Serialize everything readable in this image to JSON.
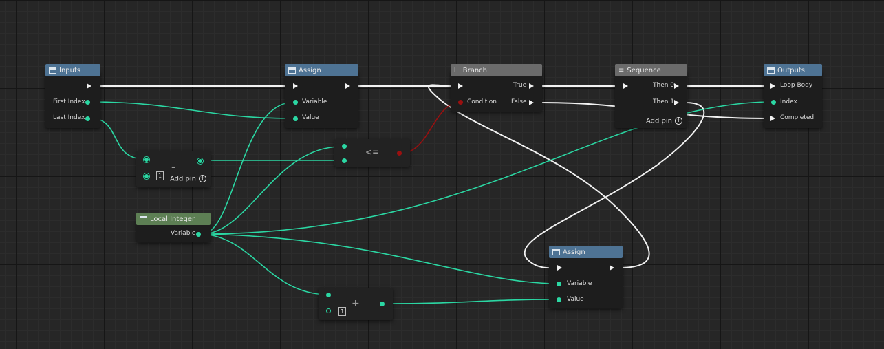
{
  "colors": {
    "background": "#262626",
    "node_body": "#1d1d1d",
    "header_blue": "#4e7394",
    "header_gray": "#6b6b6b",
    "header_green": "#5d7f54",
    "data_wire": "#2bd7a3",
    "exec_wire": "#f2f2f2",
    "bool_wire": "#9a1010"
  },
  "nodes": {
    "inputs": {
      "title": "Inputs",
      "first_index": "First Index",
      "last_index": "Last Index"
    },
    "assign_top": {
      "title": "Assign",
      "variable": "Variable",
      "value": "Value"
    },
    "branch": {
      "title": "Branch",
      "condition": "Condition",
      "true_label": "True",
      "false_label": "False"
    },
    "sequence": {
      "title": "Sequence",
      "then0": "Then 0",
      "then1": "Then 1",
      "add_pin": "Add pin"
    },
    "outputs": {
      "title": "Outputs",
      "loop_body": "Loop Body",
      "index": "Index",
      "completed": "Completed"
    },
    "subtract": {
      "operator": "-",
      "constant": "1",
      "add_pin": "Add pin"
    },
    "compare": {
      "operator": "<="
    },
    "local_integer": {
      "title": "Local Integer",
      "variable": "Variable"
    },
    "add": {
      "operator": "+",
      "constant": "1"
    },
    "assign_bottom": {
      "title": "Assign",
      "variable": "Variable",
      "value": "Value"
    }
  },
  "icons": {
    "node_header": "window-icon",
    "branch": "branch-icon",
    "sequence": "sequence-icon",
    "add_pin": "plus-circle-icon"
  }
}
